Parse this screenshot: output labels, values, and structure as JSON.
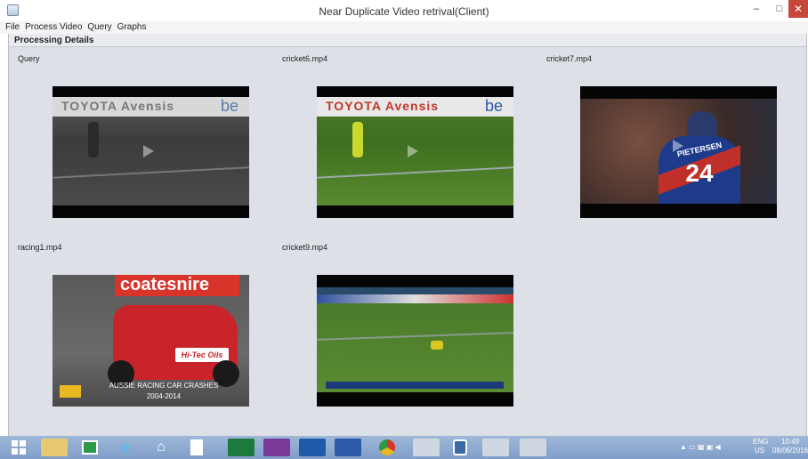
{
  "window": {
    "title": "Near Duplicate Video retrival(Client)",
    "min_glyph": "–",
    "max_glyph": "□",
    "close_glyph": "✕"
  },
  "menu": [
    "File",
    "Process Video",
    "Query",
    "Graphs"
  ],
  "panel": {
    "title": "Processing Details"
  },
  "videos": [
    {
      "label": "Query",
      "banner": "TOYOTA Avensis",
      "banner_mark": "be"
    },
    {
      "label": "cricket6.mp4",
      "banner": "TOYOTA Avensis",
      "banner_mark": "be"
    },
    {
      "label": "cricket7.mp4",
      "jersey_name": "PIETERSEN",
      "jersey_number": "24"
    },
    {
      "label": "racing1.mp4",
      "banner": "coatesnire",
      "car_text": "Hi-Tec Oils",
      "caption_1": "AUSSIE RACING CAR CRASHES",
      "caption_2": "2004-2014"
    },
    {
      "label": "cricket9.mp4"
    }
  ],
  "colors": {
    "panel_bg": "#dde0e6",
    "close_button": "#c7463a",
    "taskbar": "#8aa8cc"
  },
  "taskbar": {
    "icons": [
      "windows-start-icon",
      "file-explorer-icon",
      "store-icon",
      "internet-explorer-icon",
      "home-icon",
      "document-icon",
      "excel-icon",
      "onenote-icon",
      "outlook-icon",
      "word-icon",
      "chrome-icon",
      "media-icon",
      "virtualbox-icon",
      "java-icon",
      "java-icon"
    ],
    "lang": "ENG",
    "region": "US",
    "time": "10:49",
    "date": "08/06/2016"
  }
}
